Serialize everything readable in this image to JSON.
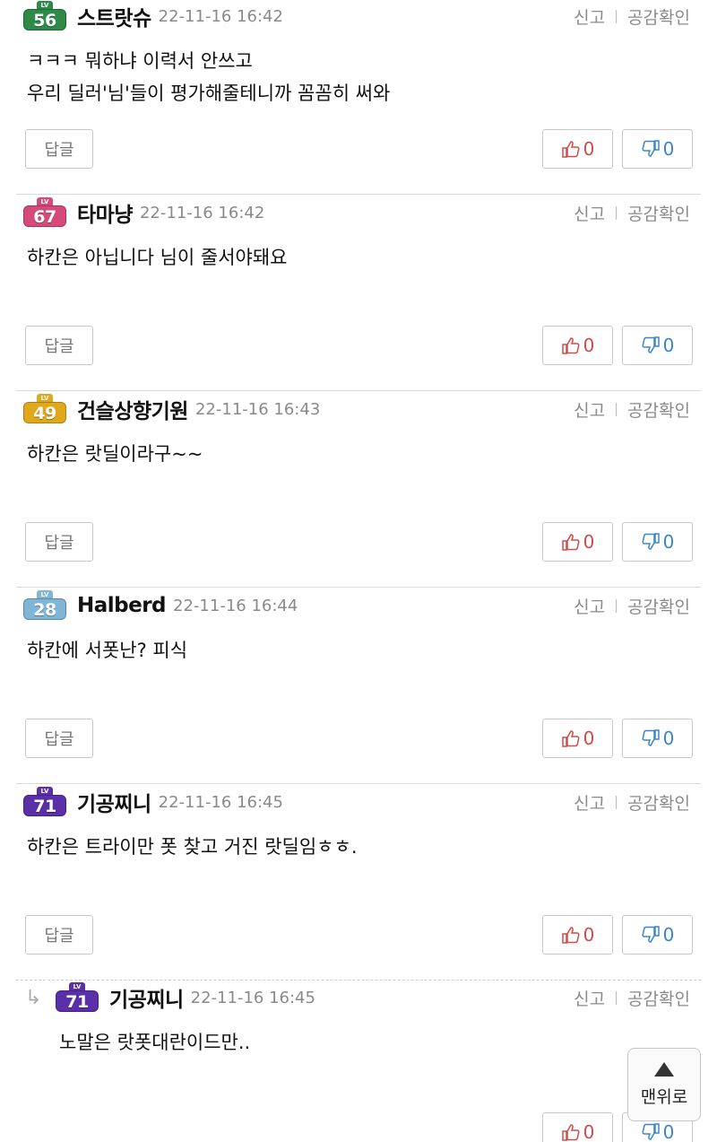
{
  "comments": [
    {
      "level": "56",
      "level_color": "#2d8a48",
      "nickname": "스트랏슈",
      "date": "22-11-16 16:42",
      "report": "신고",
      "likes_view": "공감확인",
      "text": "ㅋㅋㅋ 뭐하냐 이력서 안쓰고\n우리 딜러'님'들이 평가해줄테니까 꼼꼼히 써와",
      "reply_label": "답글",
      "up": "0",
      "down": "0"
    },
    {
      "level": "67",
      "level_color": "#d64a7a",
      "nickname": "타마냥",
      "date": "22-11-16 16:42",
      "report": "신고",
      "likes_view": "공감확인",
      "text": "하칸은 아닙니다 님이 줄서야돼요",
      "reply_label": "답글",
      "up": "0",
      "down": "0"
    },
    {
      "level": "49",
      "level_color": "#e0a81c",
      "nickname": "건슬상향기원",
      "date": "22-11-16 16:43",
      "report": "신고",
      "likes_view": "공감확인",
      "text": "하칸은 랏딜이라구~~",
      "reply_label": "답글",
      "up": "0",
      "down": "0"
    },
    {
      "level": "28",
      "level_color": "#7fb6d8",
      "nickname": "Halberd",
      "date": "22-11-16 16:44",
      "report": "신고",
      "likes_view": "공감확인",
      "text": "하칸에 서폿난? 피식",
      "reply_label": "답글",
      "up": "0",
      "down": "0"
    },
    {
      "level": "71",
      "level_color": "#5a2fa8",
      "nickname": "기공찌니",
      "date": "22-11-16 16:45",
      "report": "신고",
      "likes_view": "공감확인",
      "text": "하칸은 트라이만 폿 찾고 거진 랏딜임ㅎㅎ.",
      "reply_label": "답글",
      "up": "0",
      "down": "0"
    }
  ],
  "reply": {
    "arrow": "↳",
    "level": "71",
    "level_color": "#5a2fa8",
    "nickname": "기공찌니",
    "date": "22-11-16 16:45",
    "report": "신고",
    "likes_view": "공감확인",
    "text": "노말은 랏폿대란이드만..",
    "up": "0",
    "down": "0"
  },
  "top_button": {
    "label": "맨위로"
  },
  "colors": {
    "up": "#d34a4a",
    "down": "#3a86c8"
  }
}
